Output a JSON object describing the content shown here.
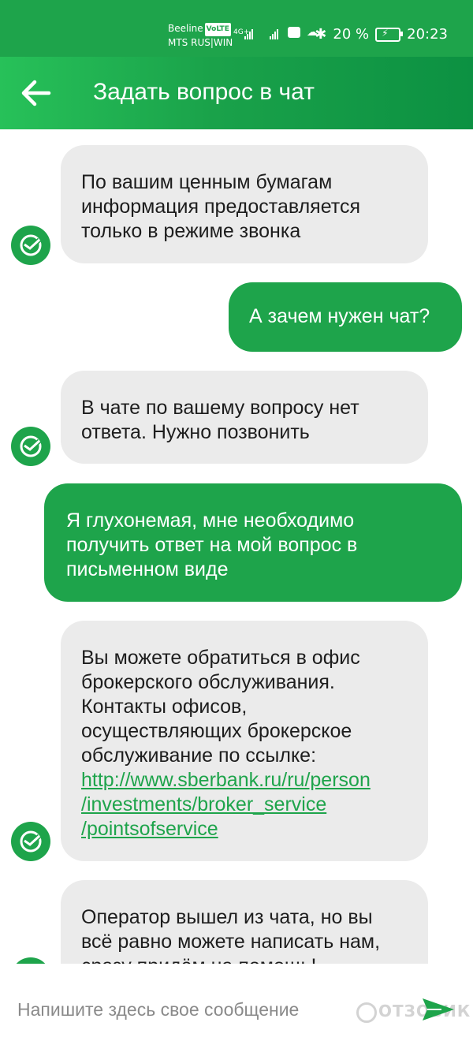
{
  "status_bar": {
    "carrier1": "Beeline",
    "volte": "VoLTE",
    "carrier2": "MTS RUS|WIN",
    "network": "4G+",
    "battery_text": "20 %",
    "time": "20:23"
  },
  "header": {
    "title": "Задать вопрос в чат"
  },
  "messages": [
    {
      "sender": "bot",
      "text": "По вашим ценным бумагам информация предоставляется только в режиме звонка"
    },
    {
      "sender": "user",
      "text": "А зачем нужен чат?"
    },
    {
      "sender": "bot",
      "text": "В чате по вашему вопросу нет ответа. Нужно позвонить"
    },
    {
      "sender": "user",
      "text": "Я глухонемая, мне необходимо получить ответ на мой вопрос в письменном виде"
    },
    {
      "sender": "bot",
      "text": "Вы можете обратиться в офис брокерского обслуживания. Контакты офисов, осуществляющих брокерское обслуживание по ссылке:",
      "link_line1": "http://www.sberbank.ru/ru/person",
      "link_line2": "/investments/broker_service",
      "link_line3": "/pointsofservice"
    },
    {
      "sender": "bot",
      "text": "Оператор вышел из чата, но вы всё равно можете написать нам, сразу придём на помощь!"
    }
  ],
  "composer": {
    "placeholder": "Напишите здесь свое сообщение"
  },
  "watermark": "ОТЗОВИК",
  "colors": {
    "primary": "#1ea44b",
    "bot_bubble": "#ebebeb",
    "user_text": "#ffffff"
  }
}
